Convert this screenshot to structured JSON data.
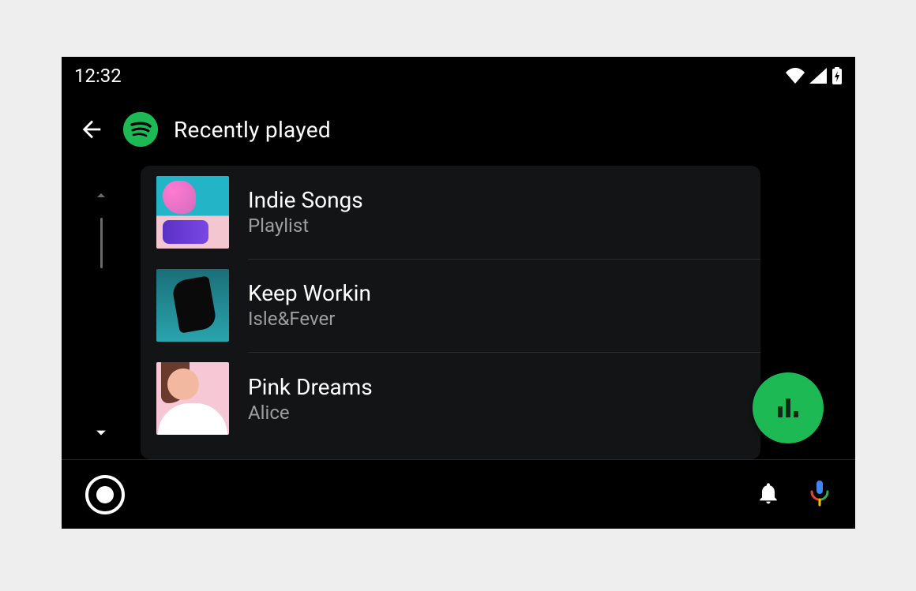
{
  "statusbar": {
    "time": "12:32"
  },
  "header": {
    "title": "Recently played"
  },
  "items": [
    {
      "title": "Indie Songs",
      "subtitle": "Playlist"
    },
    {
      "title": "Keep Workin",
      "subtitle": "Isle&Fever"
    },
    {
      "title": "Pink Dreams",
      "subtitle": "Alice"
    }
  ]
}
